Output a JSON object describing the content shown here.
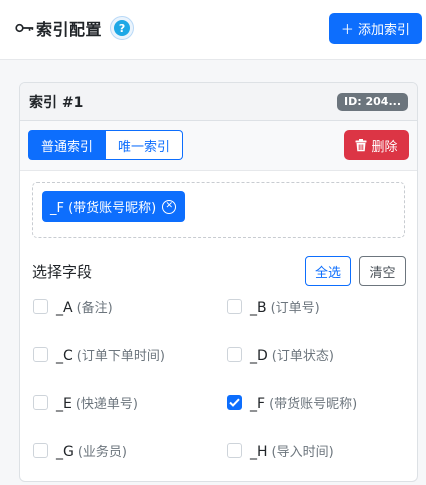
{
  "header": {
    "title": "索引配置",
    "help_label": "?",
    "add_button": "＋ 添加索引"
  },
  "card": {
    "title": "索引 #1",
    "id_badge": "ID: 204...",
    "type_tabs": [
      {
        "label": "普通索引",
        "active": true
      },
      {
        "label": "唯一索引",
        "active": false
      }
    ],
    "delete_button": "删除"
  },
  "selected_chips": [
    {
      "label": "_F (带货账号昵称)",
      "remove_icon": "circle-x-icon"
    }
  ],
  "field_selector": {
    "title": "选择字段",
    "select_all": "全选",
    "clear": "清空",
    "fields": [
      {
        "code": "_A",
        "desc": "(备注)",
        "checked": false
      },
      {
        "code": "_B",
        "desc": "(订单号)",
        "checked": false
      },
      {
        "code": "_C",
        "desc": "(订单下单时间)",
        "checked": false
      },
      {
        "code": "_D",
        "desc": "(订单状态)",
        "checked": false
      },
      {
        "code": "_E",
        "desc": "(快递单号)",
        "checked": false
      },
      {
        "code": "_F",
        "desc": "(带货账号昵称)",
        "checked": true
      },
      {
        "code": "_G",
        "desc": "(业务员)",
        "checked": false
      },
      {
        "code": "_H",
        "desc": "(导入时间)",
        "checked": false
      }
    ]
  },
  "colors": {
    "primary": "#0d6efd",
    "danger": "#dc3545",
    "badge": "#6c757d",
    "help": "#1ea8e6"
  }
}
